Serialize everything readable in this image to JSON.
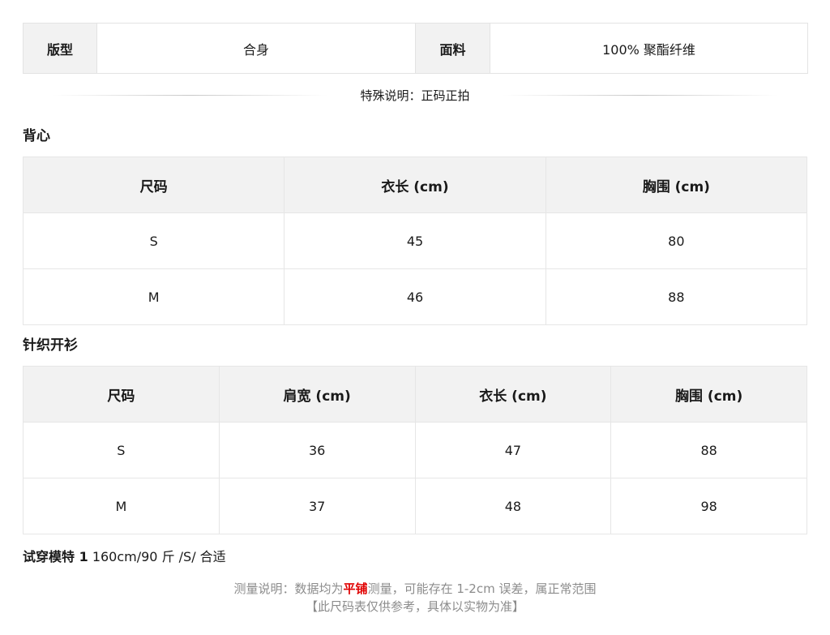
{
  "attributes": [
    {
      "key": "版型",
      "value": "合身"
    },
    {
      "key": "面料",
      "value": "100% 聚酯纤维"
    }
  ],
  "special_note": "特殊说明：正码正拍",
  "tables": [
    {
      "title": "背心",
      "headers": [
        "尺码",
        "衣长 (cm)",
        "胸围 (cm)"
      ],
      "rows": [
        [
          "S",
          "45",
          "80"
        ],
        [
          "M",
          "46",
          "88"
        ]
      ]
    },
    {
      "title": "针织开衫",
      "headers": [
        "尺码",
        "肩宽 (cm)",
        "衣长 (cm)",
        "胸围 (cm)"
      ],
      "rows": [
        [
          "S",
          "36",
          "47",
          "88"
        ],
        [
          "M",
          "37",
          "48",
          "98"
        ]
      ]
    }
  ],
  "model": {
    "label": "试穿模特 1",
    "info": "160cm/90 斤 /S/ 合适"
  },
  "footer": {
    "line1_prefix": "测量说明：数据均为",
    "line1_highlight": "平铺",
    "line1_suffix": "测量，可能存在 1-2cm 误差，属正常范围",
    "line2": "【此尺码表仅供参考，具体以实物为准】",
    "highlight_color": "#e00000"
  }
}
